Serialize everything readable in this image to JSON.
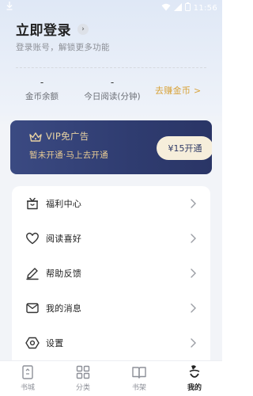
{
  "status_bar": {
    "time": "11:56"
  },
  "header": {
    "login_title": "立即登录",
    "login_subtitle": "登录账号，解锁更多功能"
  },
  "stats": {
    "coins_value": "-",
    "coins_label": "金币余额",
    "reading_value": "-",
    "reading_label": "今日阅读(分钟)",
    "earn_link": "去赚金币 >"
  },
  "vip": {
    "title": "VIP免广告",
    "subtitle": "暂未开通·马上去开通",
    "button_label": "¥15开通"
  },
  "menu": {
    "items": [
      {
        "label": "福利中心",
        "icon": "gift-icon"
      },
      {
        "label": "阅读喜好",
        "icon": "heart-icon"
      },
      {
        "label": "帮助反馈",
        "icon": "edit-icon"
      },
      {
        "label": "我的消息",
        "icon": "mail-icon"
      },
      {
        "label": "设置",
        "icon": "settings-icon"
      }
    ]
  },
  "bottom_nav": {
    "items": [
      {
        "label": "书城",
        "icon": "bookstore-icon"
      },
      {
        "label": "分类",
        "icon": "category-icon"
      },
      {
        "label": "书架",
        "icon": "bookshelf-icon"
      },
      {
        "label": "我的",
        "icon": "profile-icon",
        "active": true
      }
    ]
  },
  "colors": {
    "vip_card": "#34427a",
    "vip_gold": "#e9d3a3",
    "earn_gold": "#d8a33a",
    "page_bg": "#f2f4f8"
  }
}
